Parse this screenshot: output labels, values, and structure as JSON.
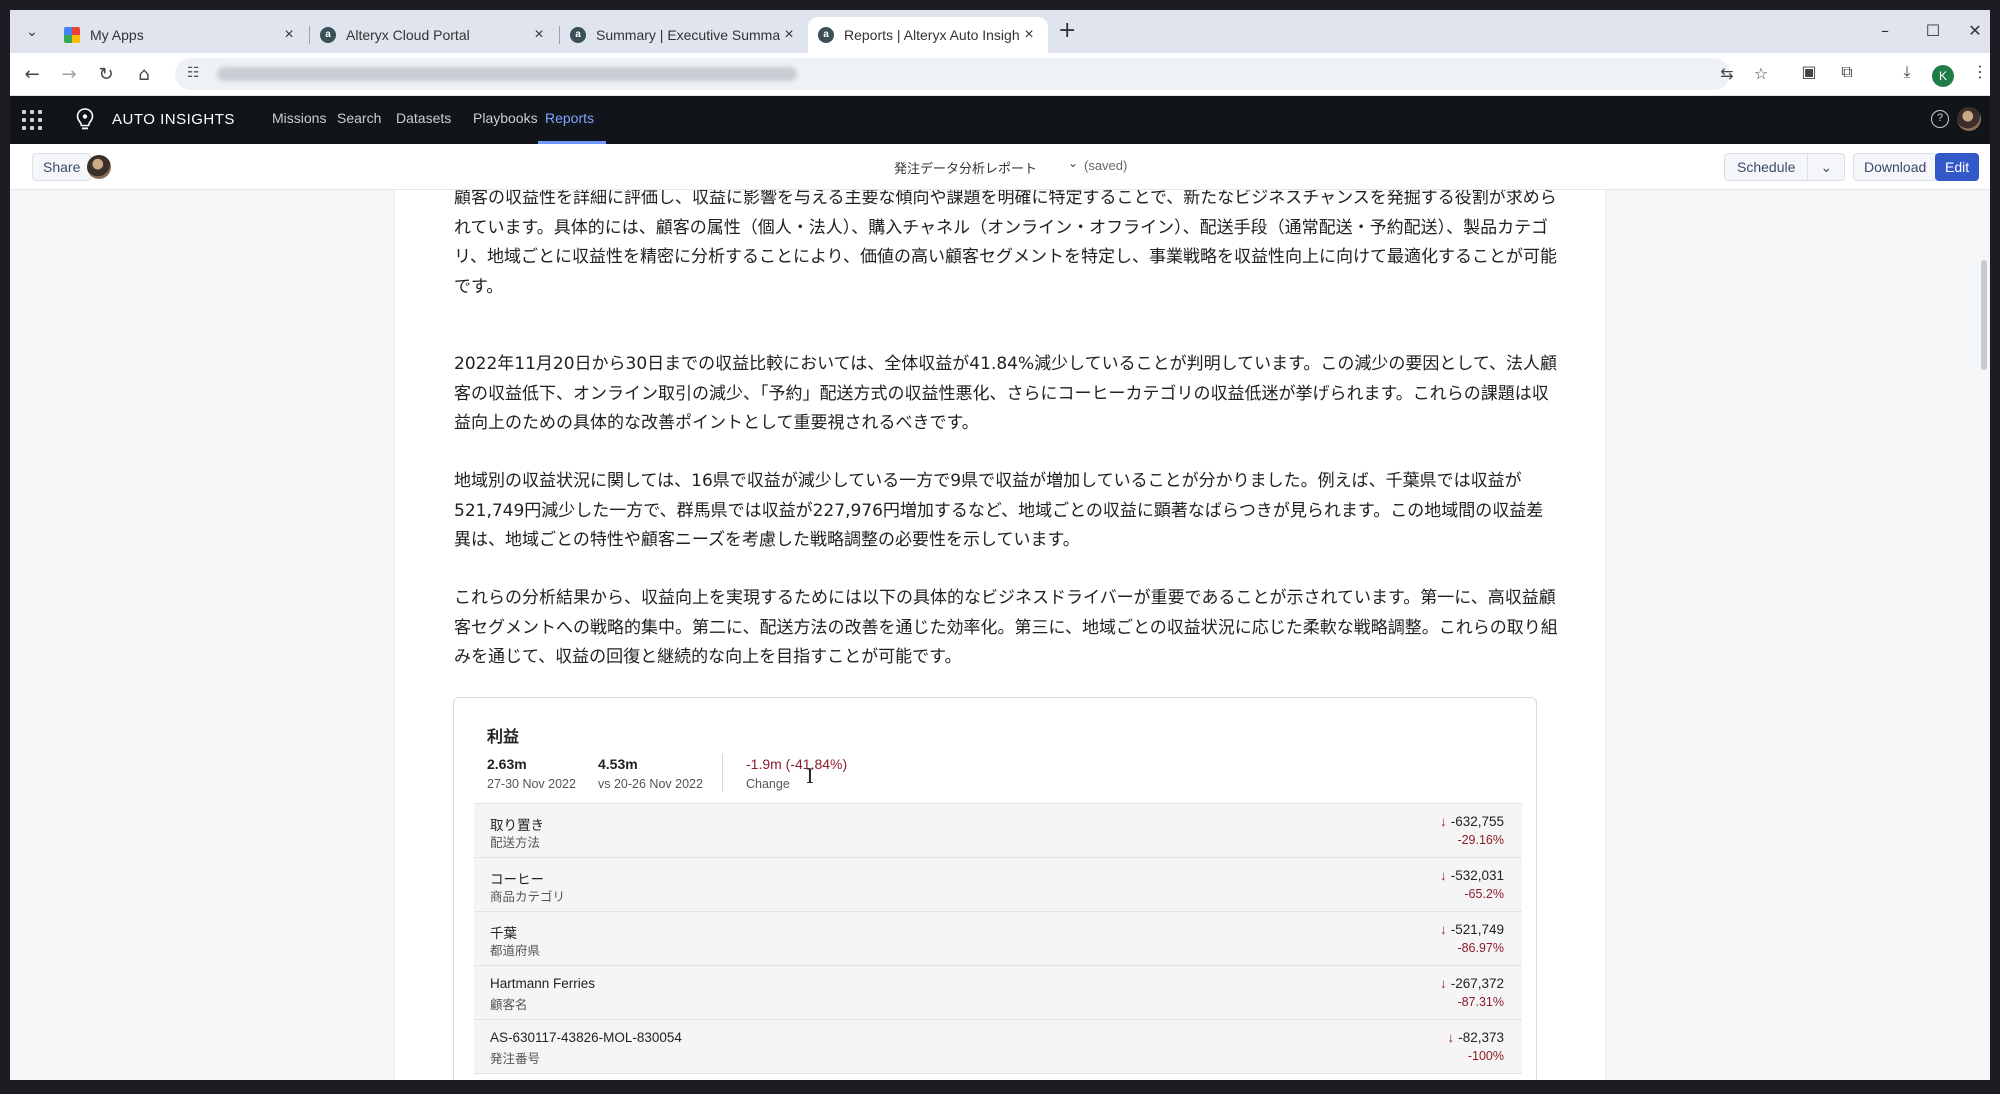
{
  "browser": {
    "tabs": [
      {
        "title": "My Apps",
        "favicon": "google-apps"
      },
      {
        "title": "Alteryx Cloud Portal",
        "favicon": "alteryx"
      },
      {
        "title": "Summary | Executive Summary",
        "favicon": "alteryx"
      },
      {
        "title": "Reports | Alteryx Auto Insights",
        "favicon": "alteryx",
        "active": true
      }
    ],
    "profile_initial": "K"
  },
  "app": {
    "name": "AUTO INSIGHTS",
    "nav": [
      "Missions",
      "Search",
      "Datasets",
      "Playbooks",
      "Reports"
    ],
    "active_nav": "Reports"
  },
  "toolbar": {
    "share_label": "Share",
    "report_title": "発注データ分析レポート",
    "saved_label": "(saved)",
    "schedule_label": "Schedule",
    "download_label": "Download",
    "edit_label": "Edit"
  },
  "paragraphs": [
    "顧客の収益性を詳細に評価し、収益に影響を与える主要な傾向や課題を明確に特定することで、新たなビジネスチャンスを発掘する役割が求められています。具体的には、顧客の属性（個人・法人）、購入チャネル（オンライン・オフライン）、配送手段（通常配送・予約配送）、製品カテゴリ、地域ごとに収益性を精密に分析することにより、価値の高い顧客セグメントを特定し、事業戦略を収益性向上に向けて最適化することが可能です。",
    "2022年11月20日から30日までの収益比較においては、全体収益が41.84%減少していることが判明しています。この減少の要因として、法人顧客の収益低下、オンライン取引の減少、「予約」配送方式の収益性悪化、さらにコーヒーカテゴリの収益低迷が挙げられます。これらの課題は収益向上のための具体的な改善ポイントとして重要視されるべきです。",
    "地域別の収益状況に関しては、16県で収益が減少している一方で9県で収益が増加していることが分かりました。例えば、千葉県では収益が521,749円減少した一方で、群馬県では収益が227,976円増加するなど、地域ごとの収益に顕著なばらつきが見られます。この地域間の収益差異は、地域ごとの特性や顧客ニーズを考慮した戦略調整の必要性を示しています。",
    "これらの分析結果から、収益向上を実現するためには以下の具体的なビジネスドライバーが重要であることが示されています。第一に、高収益顧客セグメントへの戦略的集中。第二に、配送方法の改善を通じた効率化。第三に、地域ごとの収益状況に応じた柔軟な戦略調整。これらの取り組みを通じて、収益の回復と継続的な向上を目指すことが可能です。"
  ],
  "card": {
    "title": "利益",
    "current_value": "2.63m",
    "current_period": "27-30 Nov 2022",
    "compare_value": "4.53m",
    "compare_period": "vs 20-26 Nov 2022",
    "change_value": "-1.9m (-41.84%)",
    "change_label": "Change",
    "rows": [
      {
        "name": "取り置き",
        "dimension": "配送方法",
        "value": "-632,755",
        "pct": "-29.16%"
      },
      {
        "name": "コーヒー",
        "dimension": "商品カテゴリ",
        "value": "-532,031",
        "pct": "-65.2%"
      },
      {
        "name": "千葉",
        "dimension": "都道府県",
        "value": "-521,749",
        "pct": "-86.97%"
      },
      {
        "name": "Hartmann Ferries",
        "dimension": "顧客名",
        "value": "-267,372",
        "pct": "-87.31%"
      },
      {
        "name": "AS-630117-43826-MOL-830054",
        "dimension": "発注番号",
        "value": "-82,373",
        "pct": "-100%"
      }
    ]
  },
  "colors": {
    "accent": "#3358c7",
    "negative": "#8b1e2a",
    "nav_active": "#7fa6ff",
    "header_bg": "#111419"
  }
}
